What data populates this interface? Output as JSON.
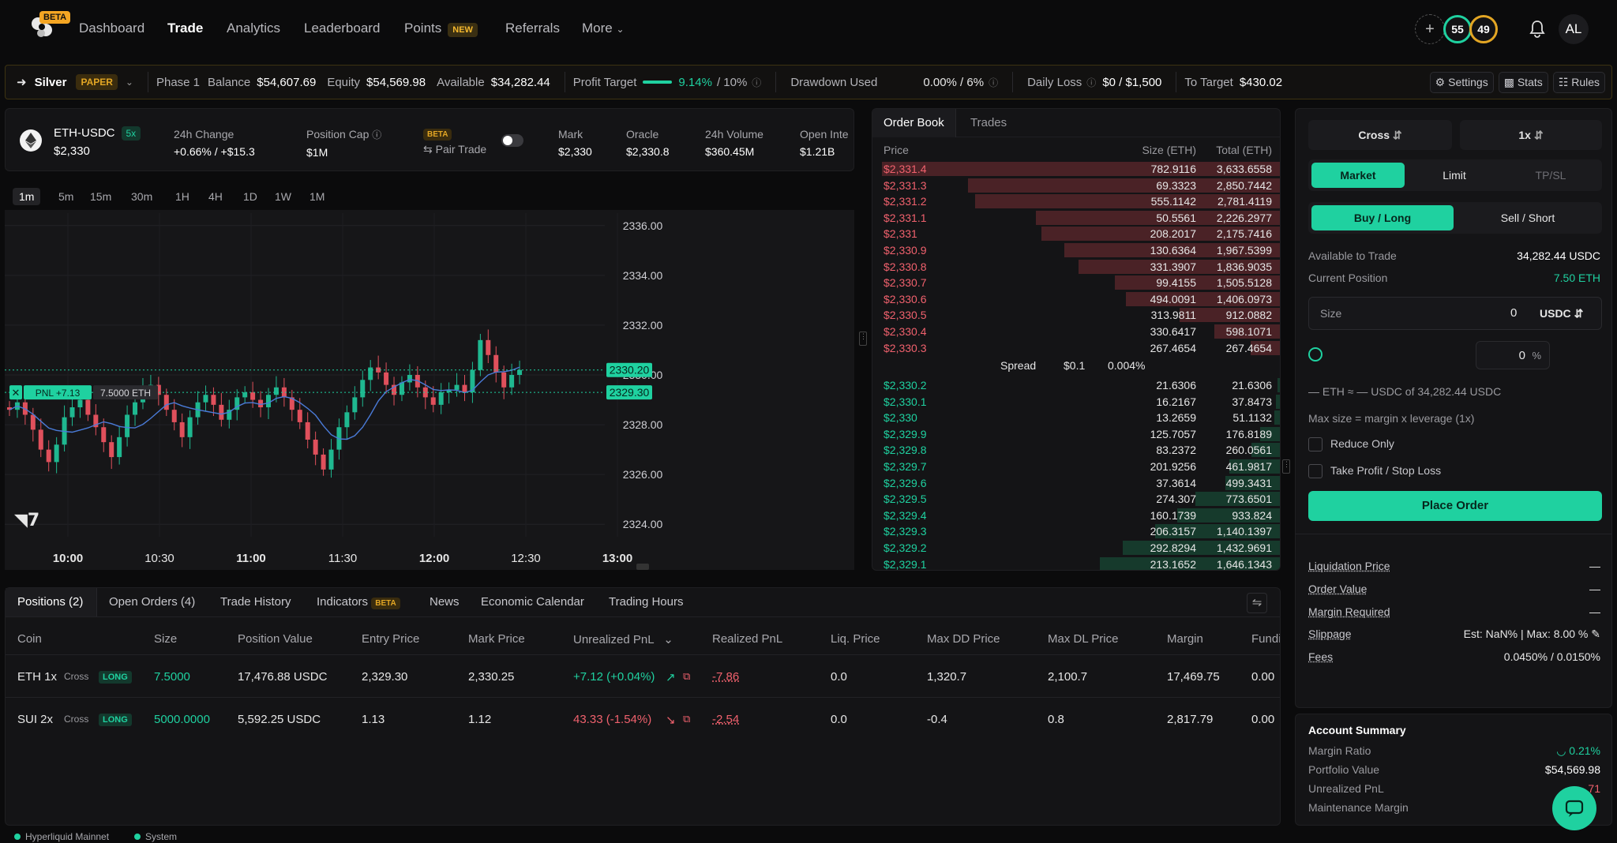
{
  "nav": {
    "beta": "BETA",
    "items": [
      "Dashboard",
      "Trade",
      "Analytics",
      "Leaderboard",
      "Points",
      "Referrals",
      "More"
    ],
    "new_badge": "NEW",
    "score_a": "55",
    "score_b": "49",
    "avatar": "AL"
  },
  "strip": {
    "tier": "Silver",
    "paper": "PAPER",
    "phase": "Phase 1",
    "balance_label": "Balance",
    "balance": "$54,607.69",
    "equity_label": "Equity",
    "equity": "$54,569.98",
    "available_label": "Available",
    "available": "$34,282.44",
    "profit_target_label": "Profit Target",
    "profit_target": "9.14%",
    "profit_target_max": "/ 10%",
    "profit_progress": 0.914,
    "drawdown_label": "Drawdown Used",
    "drawdown": "0.00% / 6%",
    "daily_loss_label": "Daily Loss",
    "daily_loss": "$0 / $1,500",
    "to_target_label": "To Target",
    "to_target": "$430.02",
    "settings": "Settings",
    "stats": "Stats",
    "rules": "Rules"
  },
  "market": {
    "pair": "ETH-USDC",
    "leverage": "5x",
    "price": "$2,330",
    "change_label": "24h Change",
    "change": "+0.66% / +$15.3",
    "cap_label": "Position Cap",
    "cap": "$1M",
    "beta": "BETA",
    "pair_trade": "Pair Trade",
    "mark_label": "Mark",
    "mark": "$2,330",
    "oracle_label": "Oracle",
    "oracle": "$2,330.8",
    "volume_label": "24h Volume",
    "volume": "$360.45M",
    "oi_label": "Open Inte",
    "oi": "$1.21B"
  },
  "timeframes": [
    "1m",
    "5m",
    "15m",
    "30m",
    "1H",
    "4H",
    "1D",
    "1W",
    "1M"
  ],
  "chart_data": {
    "type": "candlestick",
    "ylim": [
      2323.5,
      2336.5
    ],
    "yticks": [
      "2336.00",
      "2334.00",
      "2332.00",
      "2330.00",
      "2328.00",
      "2326.00",
      "2324.00"
    ],
    "xticks": [
      "10:00",
      "10:30",
      "11:00",
      "11:30",
      "12:00",
      "12:30",
      "13:00"
    ],
    "last_price_label": "2330.20",
    "last_price": 2330.2,
    "entry_label": "2329.30",
    "entry_price": 2329.3,
    "pnl_tag": "PNL +7.13",
    "size_tag": "7.5000 ETH",
    "closes": [
      2328.6,
      2328.9,
      2328.4,
      2327.8,
      2327.0,
      2326.5,
      2327.2,
      2328.3,
      2328.7,
      2329.0,
      2328.4,
      2327.9,
      2327.3,
      2326.7,
      2327.5,
      2328.4,
      2328.9,
      2329.4,
      2329.6,
      2329.2,
      2328.6,
      2328.1,
      2327.5,
      2328.3,
      2328.9,
      2329.2,
      2328.8,
      2328.2,
      2328.6,
      2329.1,
      2329.3,
      2329.0,
      2328.7,
      2329.2,
      2329.5,
      2329.1,
      2328.6,
      2328.1,
      2327.4,
      2326.8,
      2326.2,
      2327.0,
      2327.9,
      2328.5,
      2329.1,
      2329.8,
      2330.3,
      2330.1,
      2329.6,
      2329.2,
      2329.7,
      2330.0,
      2329.5,
      2329.1,
      2328.8,
      2329.3,
      2329.4,
      2329.6,
      2329.3,
      2330.2,
      2331.4,
      2330.8,
      2330.1,
      2329.5,
      2330.0,
      2330.2
    ]
  },
  "orderbook": {
    "tabs": [
      "Order Book",
      "Trades"
    ],
    "headers": [
      "Price",
      "Size (ETH)",
      "Total (ETH)"
    ],
    "asks": [
      {
        "price": "$2,331.4",
        "size": "782.9116",
        "total": "3,633.6558",
        "depth": 3633.6558
      },
      {
        "price": "$2,331.3",
        "size": "69.3323",
        "total": "2,850.7442",
        "depth": 2850.7442
      },
      {
        "price": "$2,331.2",
        "size": "555.1142",
        "total": "2,781.4119",
        "depth": 2781.4119
      },
      {
        "price": "$2,331.1",
        "size": "50.5561",
        "total": "2,226.2977",
        "depth": 2226.2977
      },
      {
        "price": "$2,331",
        "size": "208.2017",
        "total": "2,175.7416",
        "depth": 2175.7416
      },
      {
        "price": "$2,330.9",
        "size": "130.6364",
        "total": "1,967.5399",
        "depth": 1967.5399
      },
      {
        "price": "$2,330.8",
        "size": "331.3907",
        "total": "1,836.9035",
        "depth": 1836.9035
      },
      {
        "price": "$2,330.7",
        "size": "99.4155",
        "total": "1,505.5128",
        "depth": 1505.5128
      },
      {
        "price": "$2,330.6",
        "size": "494.0091",
        "total": "1,406.0973",
        "depth": 1406.0973
      },
      {
        "price": "$2,330.5",
        "size": "313.9811",
        "total": "912.0882",
        "depth": 912.0882
      },
      {
        "price": "$2,330.4",
        "size": "330.6417",
        "total": "598.1071",
        "depth": 598.1071
      },
      {
        "price": "$2,330.3",
        "size": "267.4654",
        "total": "267.4654",
        "depth": 267.4654
      }
    ],
    "spread_label": "Spread",
    "spread": "$0.1",
    "spread_pct": "0.004%",
    "bids": [
      {
        "price": "$2,330.2",
        "size": "21.6306",
        "total": "21.6306",
        "depth": 21.6306
      },
      {
        "price": "$2,330.1",
        "size": "16.2167",
        "total": "37.8473",
        "depth": 37.8473
      },
      {
        "price": "$2,330",
        "size": "13.2659",
        "total": "51.1132",
        "depth": 51.1132
      },
      {
        "price": "$2,329.9",
        "size": "125.7057",
        "total": "176.8189",
        "depth": 176.8189
      },
      {
        "price": "$2,329.8",
        "size": "83.2372",
        "total": "260.0561",
        "depth": 260.0561
      },
      {
        "price": "$2,329.7",
        "size": "201.9256",
        "total": "461.9817",
        "depth": 461.9817
      },
      {
        "price": "$2,329.6",
        "size": "37.3614",
        "total": "499.3431",
        "depth": 499.3431
      },
      {
        "price": "$2,329.5",
        "size": "274.307",
        "total": "773.6501",
        "depth": 773.6501
      },
      {
        "price": "$2,329.4",
        "size": "160.1739",
        "total": "933.824",
        "depth": 933.824
      },
      {
        "price": "$2,329.3",
        "size": "206.3157",
        "total": "1,140.1397",
        "depth": 1140.1397
      },
      {
        "price": "$2,329.2",
        "size": "292.8294",
        "total": "1,432.9691",
        "depth": 1432.9691
      },
      {
        "price": "$2,329.1",
        "size": "213.1652",
        "total": "1,646.1343",
        "depth": 1646.1343
      }
    ]
  },
  "form": {
    "margin_mode": "Cross",
    "leverage": "1x",
    "order_types": [
      "Market",
      "Limit",
      "TP/SL"
    ],
    "sides": [
      "Buy / Long",
      "Sell / Short"
    ],
    "available_label": "Available to Trade",
    "available": "34,282.44 USDC",
    "position_label": "Current Position",
    "position": "7.50 ETH",
    "size_label": "Size",
    "size_value": "0",
    "size_unit": "USDC",
    "pct_value": "0",
    "pct_unit": "%",
    "estimate": "— ETH ≈ — USDC of 34,282.44 USDC",
    "max_size": "Max size = margin x leverage (1x)",
    "reduce_only": "Reduce Only",
    "tpsl": "Take Profit / Stop Loss",
    "place_order": "Place Order",
    "liq_label": "Liquidation Price",
    "liq": "—",
    "order_value_label": "Order Value",
    "order_value": "—",
    "margin_req_label": "Margin Required",
    "margin_req": "—",
    "slippage_label": "Slippage",
    "slippage": "Est: NaN% | Max: 8.00 %",
    "fees_label": "Fees",
    "fees": "0.0450% / 0.0150%"
  },
  "account": {
    "title": "Account Summary",
    "margin_ratio_label": "Margin Ratio",
    "margin_ratio": "0.21%",
    "portfolio_label": "Portfolio Value",
    "portfolio": "$54,569.98",
    "upnl_label": "Unrealized PnL",
    "upnl": "71",
    "maint_label": "Maintenance Margin"
  },
  "positions": {
    "tabs": [
      "Positions (2)",
      "Open Orders (4)",
      "Trade History",
      "Indicators",
      "News",
      "Economic Calendar",
      "Trading Hours"
    ],
    "indicators_beta": "BETA",
    "headers": [
      "Coin",
      "Size",
      "Position Value",
      "Entry Price",
      "Mark Price",
      "Unrealized PnL",
      "Realized PnL",
      "Liq. Price",
      "Max DD Price",
      "Max DL Price",
      "Margin",
      "Fundi"
    ],
    "rows": [
      {
        "coin": "ETH 1x",
        "mode": "Cross",
        "side": "LONG",
        "size": "7.5000",
        "value": "17,476.88 USDC",
        "entry": "2,329.30",
        "mark": "2,330.25",
        "upnl": "+7.12 (+0.04%)",
        "rpnl": "-7.86",
        "liq": "0.0",
        "maxdd": "1,320.7",
        "maxdl": "2,100.7",
        "margin": "17,469.75",
        "funding": "0.00"
      },
      {
        "coin": "SUI 2x",
        "mode": "Cross",
        "side": "LONG",
        "size": "5000.0000",
        "value": "5,592.25 USDC",
        "entry": "1.13",
        "mark": "1.12",
        "upnl": "43.33 (-1.54%)",
        "rpnl": "-2.54",
        "liq": "0.0",
        "maxdd": "-0.4",
        "maxdl": "0.8",
        "margin": "2,817.79",
        "funding": "0.00"
      }
    ]
  },
  "footer": {
    "network": "Hyperliquid Mainnet",
    "system": "System"
  }
}
